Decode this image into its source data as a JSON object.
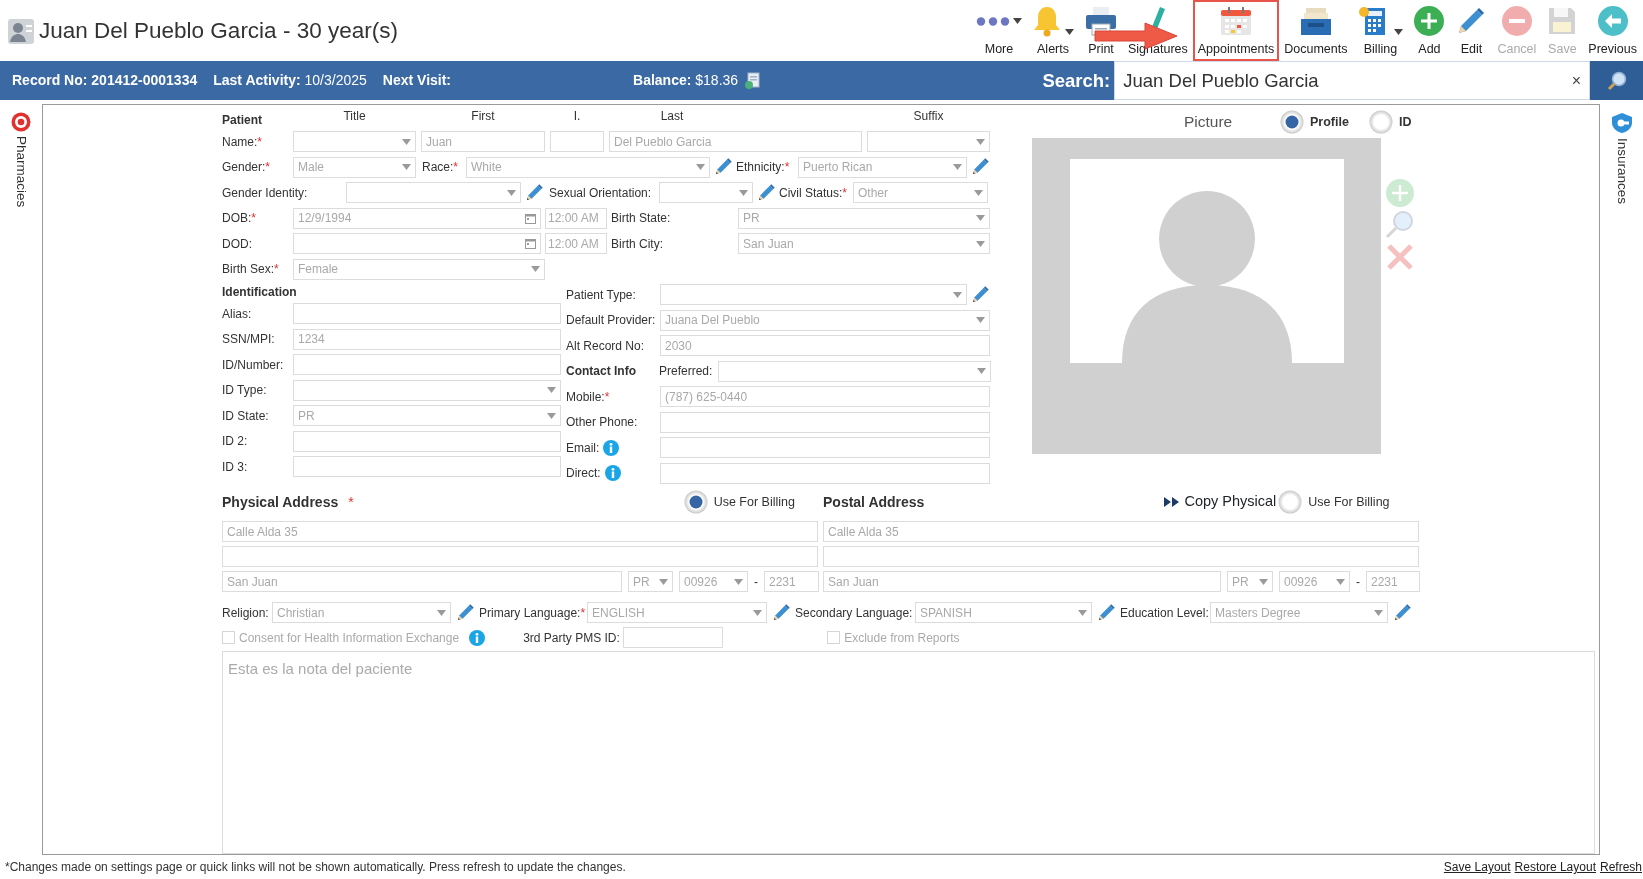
{
  "header": {
    "title": "Juan Del Pueblo Garcia - 30 year(s)"
  },
  "toolbar": [
    {
      "label": "More",
      "kind": "dots",
      "caret": true,
      "disabled": false,
      "highlighted": false
    },
    {
      "label": "Alerts",
      "kind": "bell",
      "caret": true,
      "disabled": false,
      "highlighted": false
    },
    {
      "label": "Print",
      "kind": "printer",
      "caret": false,
      "disabled": false,
      "highlighted": false
    },
    {
      "label": "Signatures",
      "kind": "signature",
      "caret": false,
      "disabled": false,
      "highlighted": false
    },
    {
      "label": "Appointments",
      "kind": "calendar",
      "caret": false,
      "disabled": false,
      "highlighted": true
    },
    {
      "label": "Documents",
      "kind": "tray",
      "caret": false,
      "disabled": false,
      "highlighted": false
    },
    {
      "label": "Billing",
      "kind": "calculator",
      "caret": true,
      "disabled": false,
      "highlighted": false
    },
    {
      "label": "Add",
      "kind": "plus",
      "caret": false,
      "disabled": false,
      "highlighted": false
    },
    {
      "label": "Edit",
      "kind": "pencil",
      "caret": false,
      "disabled": false,
      "highlighted": false
    },
    {
      "label": "Cancel",
      "kind": "minus",
      "caret": false,
      "disabled": true,
      "highlighted": false
    },
    {
      "label": "Save",
      "kind": "floppy",
      "caret": false,
      "disabled": true,
      "highlighted": false
    },
    {
      "label": "Previous",
      "kind": "back",
      "caret": false,
      "disabled": false,
      "highlighted": false
    }
  ],
  "info_bar": {
    "record_label": "Record No:",
    "record_value": "201412-0001334",
    "activity_label": "Last Activity:",
    "activity_value": "10/3/2025",
    "next_visit_label": "Next Visit:",
    "balance_label": "Balance:",
    "balance_value": "$18.36"
  },
  "search": {
    "label": "Search:",
    "value": "Juan Del Pueblo Garcia",
    "clear": "×"
  },
  "left_tab": {
    "label": "Pharmacies"
  },
  "right_tab": {
    "label": "Insurances"
  },
  "patient": {
    "read_only": true,
    "heading": "Patient",
    "column_headings": [
      "Title",
      "First",
      "I.",
      "Last",
      "Suffix"
    ],
    "name": {
      "label": "Name:",
      "required_mark": "*",
      "first": "Juan",
      "last": "Del Pueblo Garcia"
    },
    "gender": {
      "label": "Gender:",
      "required_mark": "*",
      "value": "Male"
    },
    "race": {
      "label": "Race:",
      "required_mark": "*",
      "value": "White",
      "edit": true
    },
    "ethnicity": {
      "label": "Ethnicity:",
      "required_mark": "*",
      "value": "Puerto Rican",
      "edit": true
    },
    "gender_identity": {
      "label": "Gender Identity:",
      "edit": true
    },
    "sexual_orientation": {
      "label": "Sexual Orientation:",
      "edit": true
    },
    "civil_status": {
      "label": "Civil Status:",
      "required_mark": "*",
      "value": "Other"
    },
    "dob": {
      "label": "DOB:",
      "required_mark": "*",
      "value": "12/9/1994",
      "time": "12:00 AM"
    },
    "birth_state": {
      "label": "Birth State:",
      "value": "PR"
    },
    "dod": {
      "label": "DOD:",
      "time": "12:00 AM"
    },
    "birth_city": {
      "label": "Birth City:",
      "value": "San Juan"
    },
    "birth_sex": {
      "label": "Birth Sex:",
      "required_mark": "*",
      "value": "Female"
    },
    "identification_heading": "Identification",
    "identification": [
      {
        "label": "Alias:",
        "kind": "text"
      },
      {
        "label": "SSN/MPI:",
        "kind": "text",
        "value": "1234"
      },
      {
        "label": "ID/Number:",
        "kind": "text"
      },
      {
        "label": "ID Type:",
        "kind": "select"
      },
      {
        "label": "ID State:",
        "kind": "select",
        "value": "PR"
      },
      {
        "label": "ID 2:",
        "kind": "text"
      },
      {
        "label": "ID 3:",
        "kind": "text"
      }
    ],
    "patient_type": {
      "label": "Patient Type:",
      "edit": true
    },
    "default_provider": {
      "label": "Default Provider:",
      "value": "Juana Del Pueblo"
    },
    "alt_record": {
      "label": "Alt Record No:",
      "value": "2030"
    },
    "contact_heading": "Contact Info",
    "preferred": {
      "label": "Preferred:"
    },
    "contacts": [
      {
        "label": "Mobile:",
        "required_mark": "*",
        "value": "(787) 625-0440",
        "info": false
      },
      {
        "label": "Other Phone:",
        "info": false
      },
      {
        "label": "Email:",
        "info": true
      },
      {
        "label": "Direct:",
        "info": true
      }
    ]
  },
  "picture": {
    "label": "Picture",
    "options": [
      {
        "label": "Profile",
        "selected": true
      },
      {
        "label": "ID",
        "selected": false
      }
    ]
  },
  "physical_address": {
    "title": "Physical Address",
    "required_mark": "*",
    "billing": {
      "label": "Use For Billing",
      "selected": true
    },
    "line1": "Calle Alda 35",
    "city": "San Juan",
    "state": "PR",
    "zip": "00926",
    "separator": "-",
    "zip4": "2231"
  },
  "postal_address": {
    "title": "Postal Address",
    "copy": "Copy Physical",
    "billing": {
      "label": "Use For Billing",
      "selected": false
    },
    "line1": "Calle Alda 35",
    "city": "San Juan",
    "state": "PR",
    "zip": "00926",
    "separator": "-",
    "zip4": "2231"
  },
  "details": [
    {
      "label": "Religion:",
      "value": "Christian",
      "edit": true
    },
    {
      "label": "Primary Language:",
      "required_mark": "*",
      "value": "ENGLISH",
      "edit": true
    },
    {
      "label": "Secondary Language:",
      "value": "SPANISH",
      "edit": true
    },
    {
      "label": "Education Level:",
      "value": "Masters Degree",
      "edit": true
    }
  ],
  "consent": {
    "label": "Consent for Health Information Exchange",
    "checked": false
  },
  "third_party": {
    "label": "3rd Party PMS ID:"
  },
  "exclude": {
    "label": "Exclude from Reports",
    "checked": false
  },
  "notes": {
    "value": "Esta es la nota del paciente"
  },
  "footer": {
    "note": "*Changes made on settings page or quick links will not be shown automatically. Press refresh to update the changes.",
    "links": [
      "Save Layout",
      "Restore Layout",
      "Refresh"
    ]
  }
}
